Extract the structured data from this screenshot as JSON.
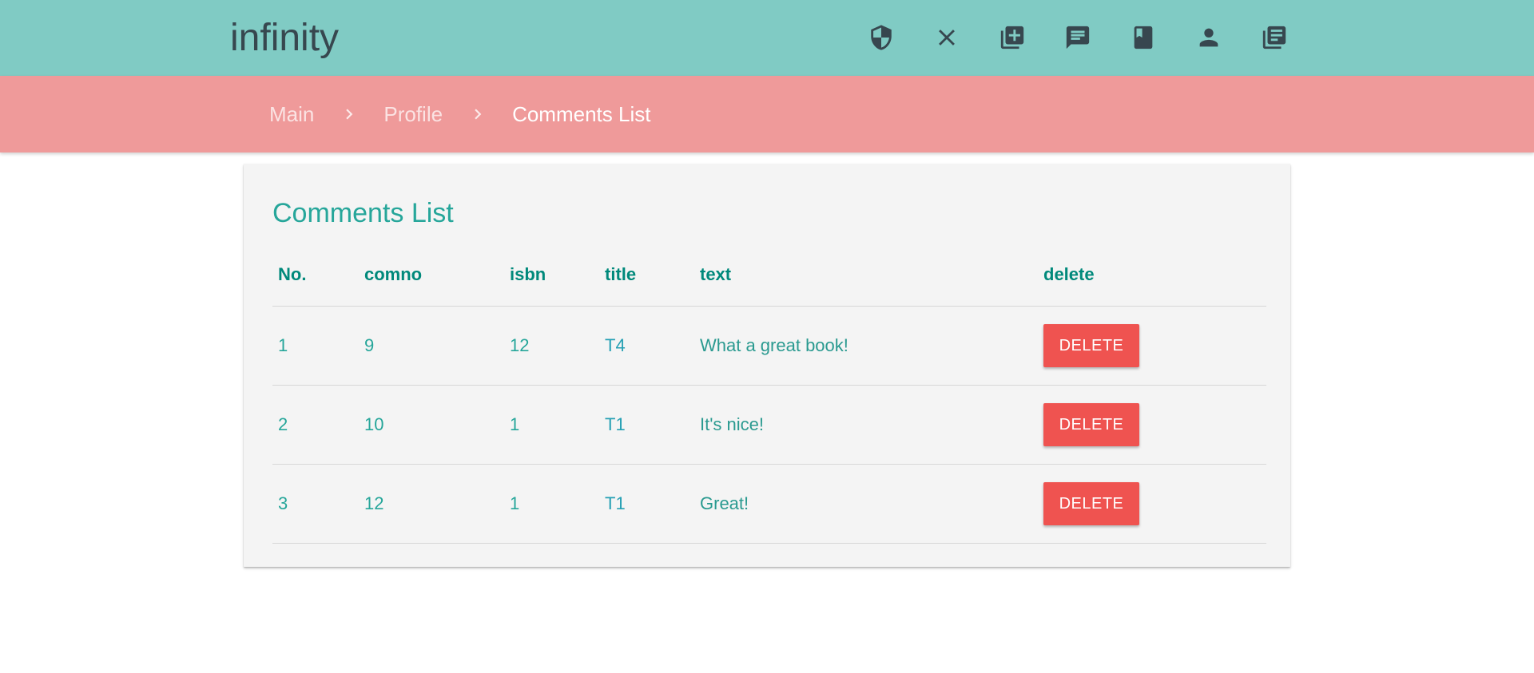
{
  "header": {
    "brand": "infinity",
    "icons": [
      "shield-icon",
      "close-icon",
      "add-library-icon",
      "comment-icon",
      "book-icon",
      "person-icon",
      "library-books-icon"
    ],
    "background": "#80cbc4"
  },
  "breadcrumb": {
    "items": [
      {
        "label": "Main"
      },
      {
        "label": "Profile"
      },
      {
        "label": "Comments List"
      }
    ],
    "background": "#ef9a9a"
  },
  "main": {
    "title": "Comments List",
    "table": {
      "headers": [
        "No.",
        "comno",
        "isbn",
        "title",
        "text",
        "delete"
      ],
      "rows": [
        {
          "no": "1",
          "comno": "9",
          "isbn": "12",
          "title": "T4",
          "text": "What a great book!",
          "action": "DELETE"
        },
        {
          "no": "2",
          "comno": "10",
          "isbn": "1",
          "title": "T1",
          "text": "It's nice!",
          "action": "DELETE"
        },
        {
          "no": "3",
          "comno": "12",
          "isbn": "1",
          "title": "T1",
          "text": "Great!",
          "action": "DELETE"
        }
      ]
    },
    "accent": "#26a69a",
    "delete_color": "#ef5350"
  }
}
